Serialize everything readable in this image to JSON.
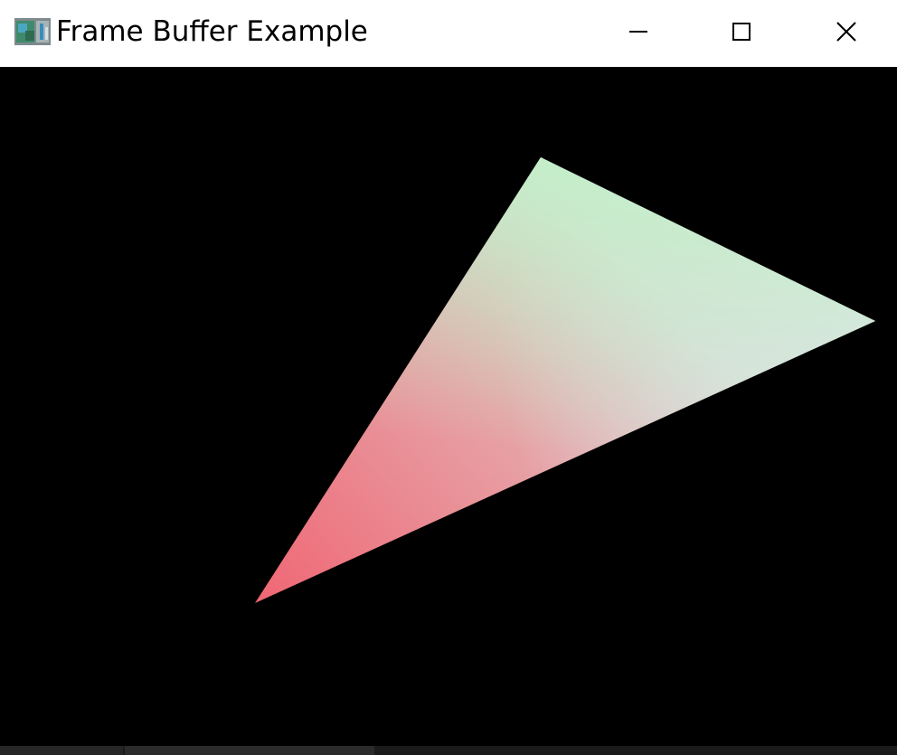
{
  "window": {
    "title": "Frame Buffer Example",
    "icon": "framebuffer-app-icon"
  },
  "caption_buttons": {
    "minimize": "minimize-icon",
    "maximize": "maximize-icon",
    "close": "close-icon"
  },
  "scene": {
    "background_color": "#000000",
    "triangle_vertex_colors": {
      "top": "#c2f0c8",
      "right": "#e6e2f2",
      "bottom_left": "#f06674"
    }
  }
}
